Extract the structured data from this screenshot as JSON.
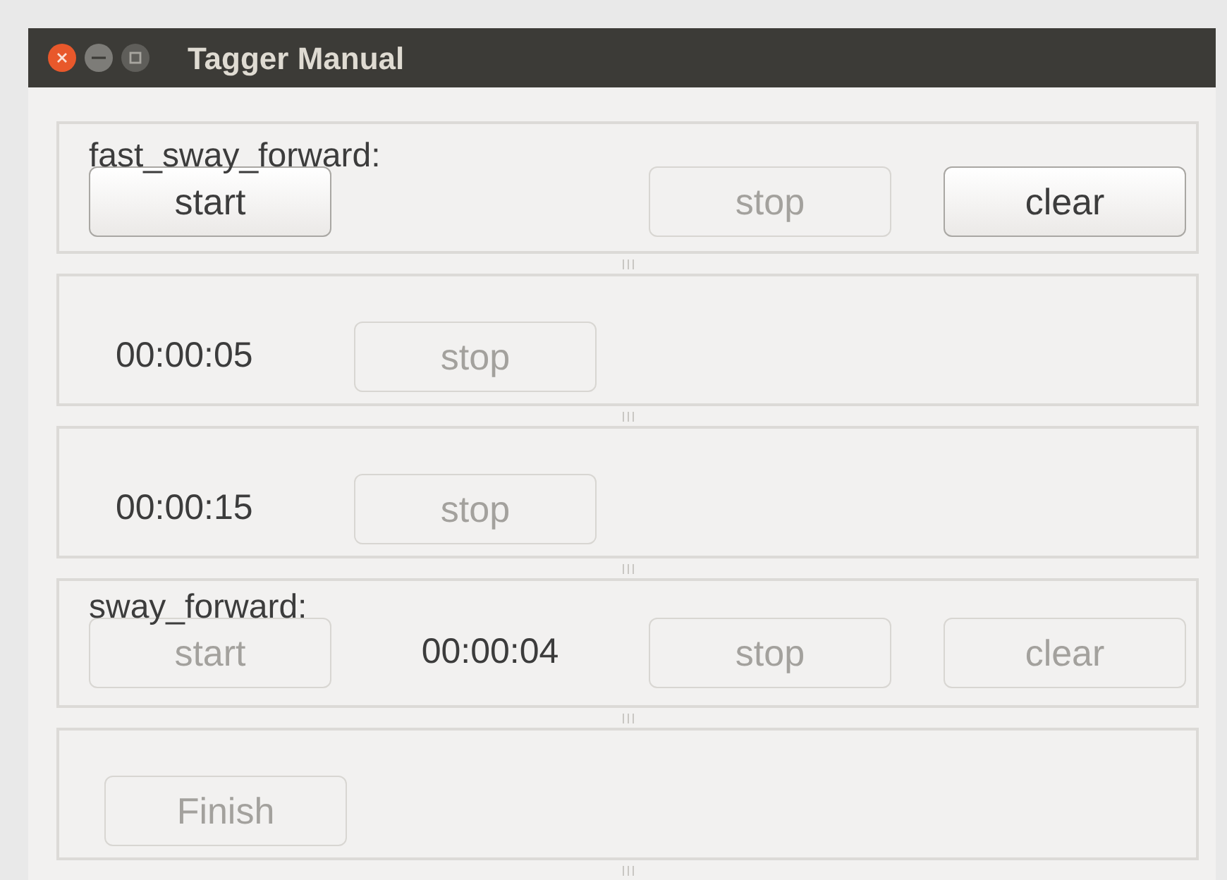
{
  "window": {
    "title": "Tagger Manual"
  },
  "panels": [
    {
      "kind": "action",
      "label": "fast_sway_forward:",
      "start": {
        "label": "start",
        "disabled": false
      },
      "stop": {
        "label": "stop",
        "disabled": true
      },
      "clear": {
        "label": "clear",
        "disabled": false
      }
    },
    {
      "kind": "timer",
      "time": "00:00:05",
      "stop": {
        "label": "stop",
        "disabled": true
      }
    },
    {
      "kind": "timer",
      "time": "00:00:15",
      "stop": {
        "label": "stop",
        "disabled": true
      }
    },
    {
      "kind": "action",
      "label": "sway_forward:",
      "start": {
        "label": "start",
        "disabled": true
      },
      "time": "00:00:04",
      "stop": {
        "label": "stop",
        "disabled": true
      },
      "clear": {
        "label": "clear",
        "disabled": true
      }
    },
    {
      "kind": "finish",
      "finish": {
        "label": "Finish",
        "disabled": true
      }
    }
  ]
}
